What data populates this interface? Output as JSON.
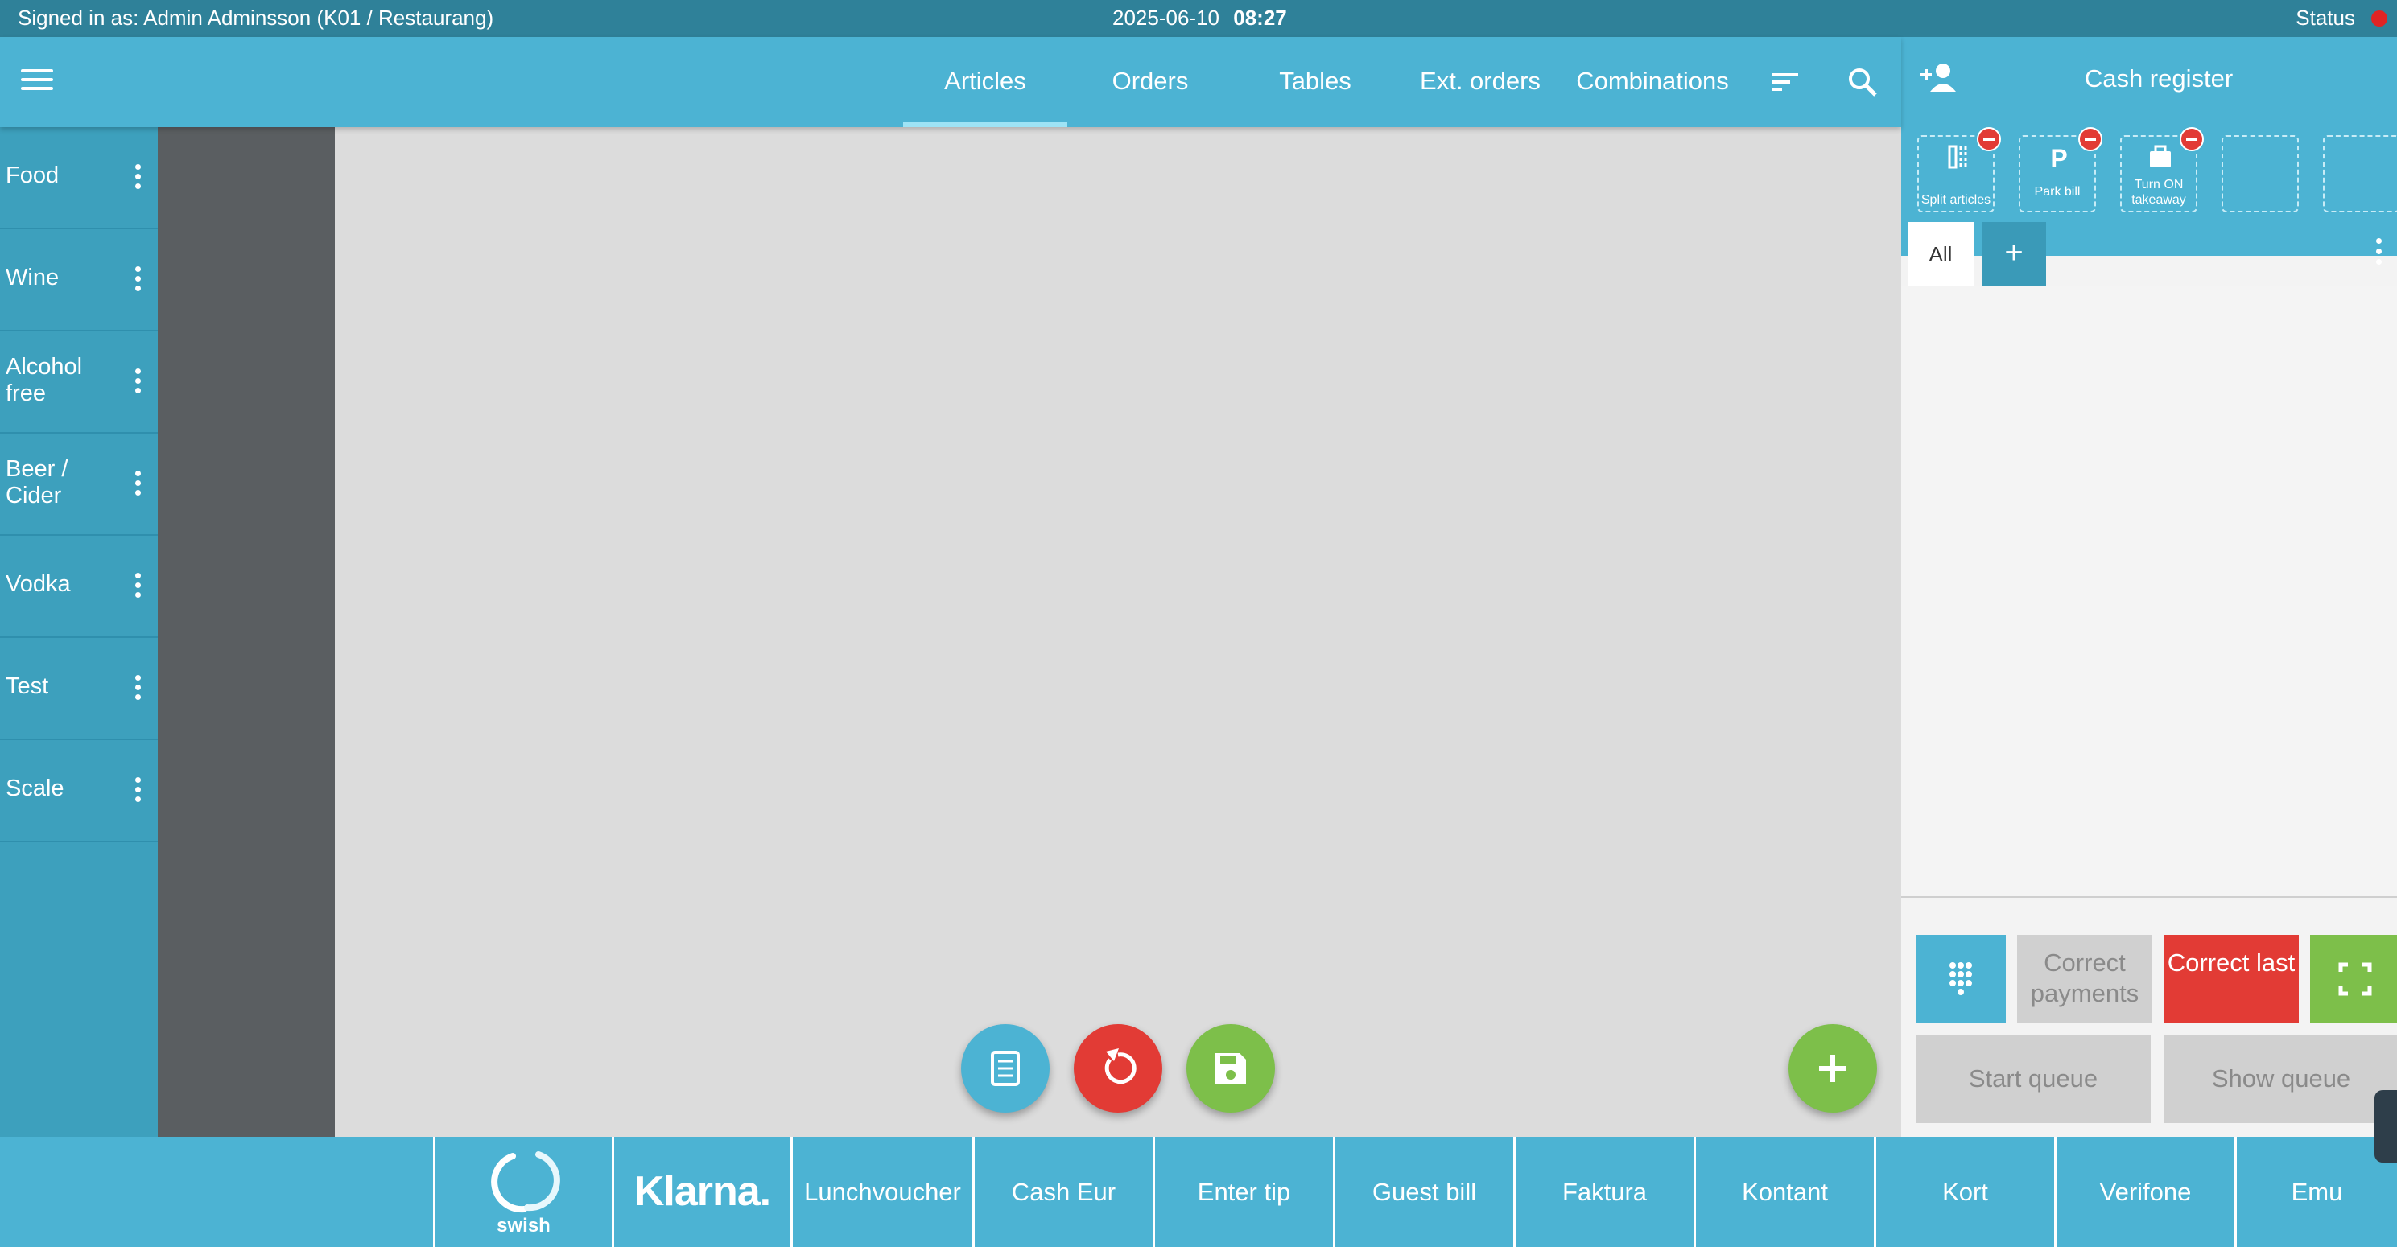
{
  "status_bar": {
    "signed_in": "Signed in as: Admin Adminsson (K01 / Restaurang)",
    "date": "2025-06-10",
    "time": "08:27",
    "status_label": "Status",
    "status_color": "#e02424"
  },
  "nav": {
    "tabs": [
      {
        "label": "Articles",
        "active": true
      },
      {
        "label": "Orders"
      },
      {
        "label": "Tables"
      },
      {
        "label": "Ext. orders"
      },
      {
        "label": "Combinations"
      }
    ],
    "icons": [
      "menu-icon",
      "sort-icon",
      "search-icon"
    ]
  },
  "categories": [
    {
      "label": "Food"
    },
    {
      "label": "Wine"
    },
    {
      "label": "Alcohol free"
    },
    {
      "label": "Beer / Cider"
    },
    {
      "label": "Vodka"
    },
    {
      "label": "Test"
    },
    {
      "label": "Scale"
    }
  ],
  "fabs": {
    "receipt": {
      "icon": "receipt-icon",
      "color": "#4cb3d3"
    },
    "undo": {
      "icon": "undo-icon",
      "color": "#e23b35"
    },
    "save": {
      "icon": "save-icon",
      "color": "#7dbf4a"
    },
    "add": {
      "icon": "plus-icon",
      "color": "#7dbf4a"
    }
  },
  "register": {
    "title": "Cash register",
    "quick_buttons": [
      {
        "label": "Split articles",
        "icon": "split-icon"
      },
      {
        "label": "Park bill",
        "icon": "park-icon"
      },
      {
        "label": "Turn ON takeaway",
        "icon": "bag-icon"
      },
      {
        "label": ""
      },
      {
        "label": ""
      }
    ],
    "filter_all": "All",
    "filter_add": "+",
    "actions": {
      "correct_payments": "Correct payments",
      "correct_last": "Correct last",
      "start_queue": "Start queue",
      "show_queue": "Show queue"
    },
    "colors": {
      "keypad": "#4cb3d3",
      "correct_last": "#e23b35",
      "fullscreen": "#7dbf4a"
    }
  },
  "payments": [
    {
      "label": "swish",
      "kind": "logo"
    },
    {
      "label": "Klarna.",
      "kind": "logo"
    },
    {
      "label": "Lunchvoucher"
    },
    {
      "label": "Cash Eur"
    },
    {
      "label": "Enter tip"
    },
    {
      "label": "Guest bill"
    },
    {
      "label": "Faktura"
    },
    {
      "label": "Kontant"
    },
    {
      "label": "Kort"
    },
    {
      "label": "Verifone"
    },
    {
      "label": "Emu"
    }
  ]
}
